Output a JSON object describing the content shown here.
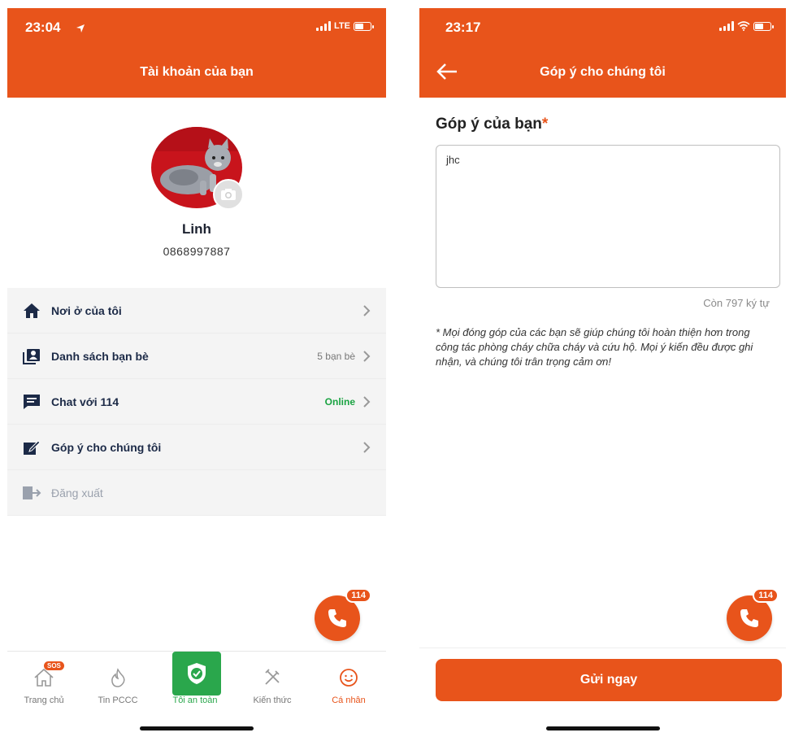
{
  "colors": {
    "brand": "#e8541b",
    "safe": "#2aa74c",
    "online": "#1aa342"
  },
  "left": {
    "status": {
      "time": "23:04",
      "network": "LTE"
    },
    "header": {
      "title": "Tài khoản của bạn"
    },
    "profile": {
      "name": "Linh",
      "phone": "0868997887"
    },
    "menu": [
      {
        "icon": "home-icon",
        "label": "Nơi ở của tôi",
        "value": ""
      },
      {
        "icon": "contacts-icon",
        "label": "Danh sách bạn bè",
        "value": "5 bạn bè"
      },
      {
        "icon": "chat-icon",
        "label": "Chat với 114",
        "value": "Online"
      },
      {
        "icon": "edit-icon",
        "label": "Góp ý cho chúng tôi",
        "value": ""
      },
      {
        "icon": "logout-icon",
        "label": "Đăng xuất",
        "value": ""
      }
    ],
    "fab": {
      "badge": "114"
    },
    "tabs": [
      {
        "icon": "home-icon",
        "label": "Trang chủ",
        "badge": "SOS"
      },
      {
        "icon": "fire-icon",
        "label": "Tin PCCC"
      },
      {
        "icon": "shield-icon",
        "label": "Tôi an toàn"
      },
      {
        "icon": "tools-icon",
        "label": "Kiến thức"
      },
      {
        "icon": "smile-icon",
        "label": "Cá nhân"
      }
    ]
  },
  "right": {
    "status": {
      "time": "23:17"
    },
    "header": {
      "title": "Góp ý cho chúng tôi"
    },
    "form": {
      "label": "Góp ý của bạn",
      "required_mark": "*",
      "value": "jhc",
      "counter": "Còn 797 ký tự",
      "note": "* Mọi đóng góp của các bạn sẽ giúp chúng tôi hoàn thiện hơn trong công tác phòng cháy chữa cháy và cứu hộ. Mọi ý kiến đều được ghi nhận, và chúng tôi trân trọng cảm ơn!"
    },
    "fab": {
      "badge": "114"
    },
    "submit_label": "Gửi ngay"
  }
}
